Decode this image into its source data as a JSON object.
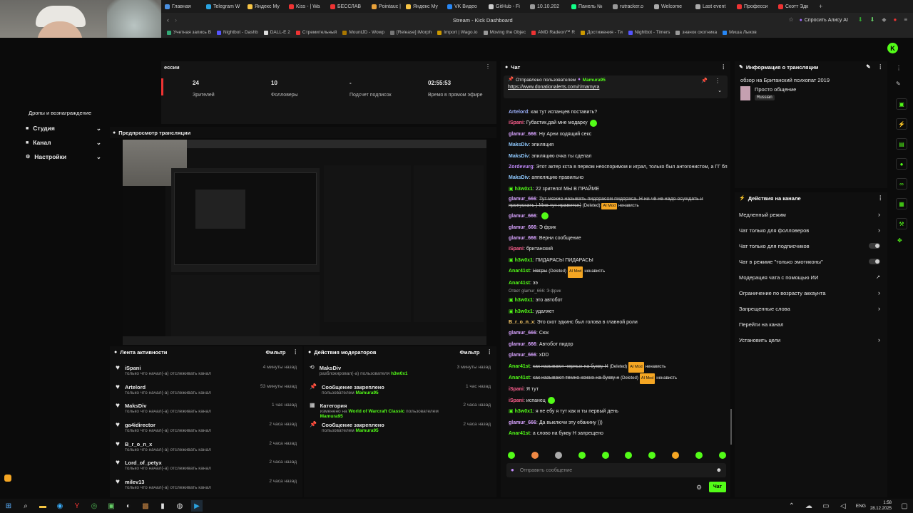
{
  "browser": {
    "tabs": [
      {
        "label": "Главная",
        "color": "#4a90e2"
      },
      {
        "label": "Telegram W",
        "color": "#2aa3e0"
      },
      {
        "label": "Яндекс Му",
        "color": "#f6c445"
      },
      {
        "label": "Kiss - | Wa",
        "color": "#e33"
      },
      {
        "label": "БЕССЛАВ",
        "color": "#e33"
      },
      {
        "label": "Pointauc |",
        "color": "#e8a13a"
      },
      {
        "label": "Яндекс Му",
        "color": "#f6c445"
      },
      {
        "label": "VK Видео",
        "color": "#2787f5"
      },
      {
        "label": "GitHub - Fi",
        "color": "#ccc"
      },
      {
        "label": "10.10.202",
        "color": "#999"
      },
      {
        "label": "Панель №",
        "color": "#1f8"
      },
      {
        "label": "rutracker.o",
        "color": "#999"
      },
      {
        "label": "Welcome",
        "color": "#aaa"
      },
      {
        "label": "Last event",
        "color": "#aaa"
      },
      {
        "label": "Професси",
        "color": "#e33"
      },
      {
        "label": "Скотт Эдк",
        "color": "#e33"
      }
    ],
    "window_title": "Stream - Kick Dashboard",
    "ask_alice": "Спросить Алису AI",
    "bookmarks": [
      {
        "label": "Учетная запись B",
        "color": "#3a7"
      },
      {
        "label": "Nightbot - Dashb",
        "color": "#55f"
      },
      {
        "label": "DALL-E 2",
        "color": "#ddd"
      },
      {
        "label": "Стремительный",
        "color": "#e33"
      },
      {
        "label": "MountJD - Wowp",
        "color": "#a70"
      },
      {
        "label": "[Release] iMorph",
        "color": "#777"
      },
      {
        "label": "Import | Wago.io",
        "color": "#c90"
      },
      {
        "label": "Moving the Objec",
        "color": "#999"
      },
      {
        "label": "AMD Radeon™ R",
        "color": "#e33"
      },
      {
        "label": "Достижения - Ти",
        "color": "#c90"
      },
      {
        "label": "Nightbot - Timers",
        "color": "#55f"
      },
      {
        "label": "значок охотника",
        "color": "#999"
      },
      {
        "label": "Миша Лыков",
        "color": "#2787f5"
      }
    ]
  },
  "sidebar": {
    "cut_label": "Дропы и вознаграждение",
    "items": [
      {
        "label": "Студия"
      },
      {
        "label": "Канал"
      },
      {
        "label": "Настройки"
      }
    ]
  },
  "stats": {
    "session_label": "ессии",
    "cards": [
      {
        "value": "24",
        "label": "Зрителей"
      },
      {
        "value": "10",
        "label": "Фолловеры"
      },
      {
        "value": "-",
        "label": "Подсчет подписок"
      },
      {
        "value": "02:55:53",
        "label": "Время в прямом эфире"
      }
    ]
  },
  "preview": {
    "title": "Предпросмотр трансляции"
  },
  "activity": {
    "title": "Лента активности",
    "filter": "Фильтр",
    "action": "только что начал(-а) отслеживать канал",
    "items": [
      {
        "user": "iSpani",
        "time": "4 минуты назад"
      },
      {
        "user": "Artelord",
        "time": "53 минуты назад"
      },
      {
        "user": "MaksDiv",
        "time": "1 час назад"
      },
      {
        "user": "ga4idirector",
        "time": "2 часа назад"
      },
      {
        "user": "B_r_o_n_x",
        "time": "2 часа назад"
      },
      {
        "user": "Lord_of_petyx",
        "time": "2 часа назад"
      },
      {
        "user": "milev13",
        "time": "2 часа назад"
      }
    ]
  },
  "modactions": {
    "title": "Действия модераторов",
    "filter": "Фильтр",
    "items": [
      {
        "title": "MaksDiv",
        "pre": "разблокировал(-а) пользователя",
        "hl": "h3w0x1",
        "mid": "",
        "hl2": "",
        "time": "3 минуты назад",
        "icon": "⟲"
      },
      {
        "title": "Сообщение закреплено",
        "pre": "пользователем",
        "hl": "Mamura95",
        "mid": "",
        "hl2": "",
        "time": "1 час назад",
        "icon": "📌"
      },
      {
        "title": "Категория",
        "pre": "изменено на",
        "hl": "World of Warcraft Classic",
        "mid": "пользователем",
        "hl2": "Mamura95",
        "time": "2 часа назад",
        "icon": "▦"
      },
      {
        "title": "Сообщение закреплено",
        "pre": "пользователем",
        "hl": "Mamura95",
        "mid": "",
        "hl2": "",
        "time": "2 часа назад",
        "icon": "📌"
      }
    ]
  },
  "chat": {
    "title": "Чат",
    "pinned_label": "Отправлено пользователем",
    "pinned_user": "Mamura95",
    "pinned_link": "https://www.donationalerts.com/r/mamyra",
    "reply_hint": "Ответ glamur_666: Э фрик",
    "input_placeholder": "Отправить сообщение",
    "send_label": "Чат",
    "ai_mod": "AI Mod",
    "messages": [
      {
        "user": "Artelord",
        "color": "#9fb3ff",
        "text": "как тут испанцев поставить?"
      },
      {
        "user": "iSpani",
        "color": "#ff5f8f",
        "text": "Губастик,дай мне модарку",
        "emote": true
      },
      {
        "user": "glamur_666",
        "color": "#d8a3ff",
        "text": "Ну Арни ходящий секс"
      },
      {
        "user": "MaksDiv",
        "color": "#8fc9ff",
        "text": "эпиляция"
      },
      {
        "user": "MaksDiv",
        "color": "#8fc9ff",
        "text": "эпиляцию очка ты сделал"
      },
      {
        "user": "Zordevurg",
        "color": "#c48bff",
        "text": "Этот актер кста в первом неоспоримом и играл, только был антогонистом, а ГГ блэйд"
      },
      {
        "user": "MaksDiv",
        "color": "#8fc9ff",
        "text": "аппеляцию правильно"
      },
      {
        "user": "h3w0x1",
        "color": "#53fc18",
        "text": "22 зрителя! МЫ В ПРАЙМЕ",
        "icon": true
      },
      {
        "user": "glamur_666",
        "color": "#d8a3ff",
        "text": "Тут можно называть пидорасом пидораса. Н ни чё не надо осуждать и пропускать ) Мне тут нравится)",
        "deleted": true,
        "tag": "ненависть"
      },
      {
        "user": "glamur_666",
        "color": "#d8a3ff",
        "text": "",
        "emote": true
      },
      {
        "user": "glamur_666",
        "color": "#d8a3ff",
        "text": "Э фрик"
      },
      {
        "user": "glamur_666",
        "color": "#d8a3ff",
        "text": "Верни сообщение"
      },
      {
        "user": "iSpani",
        "color": "#ff5f8f",
        "text": "британский"
      },
      {
        "user": "h3w0x1",
        "color": "#53fc18",
        "text": "ПИДАРАСЫ ПИДАРАСЫ",
        "icon": true
      },
      {
        "user": "Anar41st",
        "color": "#53fc18",
        "text": "Негры",
        "deleted": true,
        "tag": "ненависть"
      },
      {
        "user": "Anar41st",
        "color": "#53fc18",
        "text": "ээ"
      },
      {
        "user": "h3w0x1",
        "color": "#53fc18",
        "text": "это автобот",
        "icon": true,
        "reply": true
      },
      {
        "user": "h3w0x1",
        "color": "#53fc18",
        "text": "удаляет",
        "icon": true
      },
      {
        "user": "B_r_o_n_x",
        "color": "#ffcf6b",
        "text": "Это скот эдкинс был голова в главной роли"
      },
      {
        "user": "glamur_666",
        "color": "#d8a3ff",
        "text": "Сюк"
      },
      {
        "user": "glamur_666",
        "color": "#d8a3ff",
        "text": "Автобот пидор"
      },
      {
        "user": "glamur_666",
        "color": "#d8a3ff",
        "text": "xDD"
      },
      {
        "user": "Anar41st",
        "color": "#53fc18",
        "text": "как называют черных на букву Н",
        "deleted": true,
        "tag": "ненависть"
      },
      {
        "user": "Anar41st",
        "color": "#53fc18",
        "text": "как называют темно кожих на букву н",
        "deleted": true,
        "tag": "ненависть"
      },
      {
        "user": "iSpani",
        "color": "#ff5f8f",
        "text": "Я тут"
      },
      {
        "user": "iSpani",
        "color": "#ff5f8f",
        "text": "испанец",
        "emote": true
      },
      {
        "user": "h3w0x1",
        "color": "#53fc18",
        "text": "я не ебу я тут как и ты первый день",
        "icon": true
      },
      {
        "user": "glamur_666",
        "color": "#d8a3ff",
        "text": "Да выключи эту ебанину )))"
      },
      {
        "user": "Anar41st",
        "color": "#53fc18",
        "text": "а слово на букву Н запрещено"
      }
    ],
    "deleted_label": "(Deleted)"
  },
  "info": {
    "title": "Информация о трансляции",
    "stream_title": "обзор на Британский психопат 2019",
    "category": "Просто общение",
    "language": "Russian"
  },
  "channel_actions": {
    "title": "Действия на канале",
    "items": [
      {
        "label": "Медленный режим",
        "ctl": "chevron"
      },
      {
        "label": "Чат только для фолловеров",
        "ctl": "chevron"
      },
      {
        "label": "Чат только для подписчиков",
        "ctl": "toggle"
      },
      {
        "label": "Чат в режиме \"только эмотиконы\"",
        "ctl": "toggle"
      },
      {
        "label": "Модерация чата с помощью ИИ",
        "ctl": "ext"
      },
      {
        "label": "Ограничение по возрасту аккаунта",
        "ctl": "chevron"
      },
      {
        "label": "Запрещенные слова",
        "ctl": "chevron"
      },
      {
        "label": "Перейти на канал",
        "ctl": "none"
      },
      {
        "label": "Установить цели",
        "ctl": "chevron"
      }
    ]
  },
  "taskbar": {
    "lang": "ENG",
    "time": "1:58",
    "date": "28.12.2025"
  }
}
